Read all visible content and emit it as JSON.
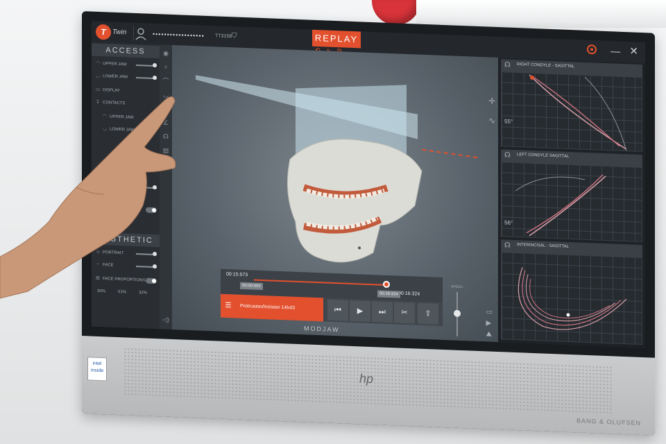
{
  "app": {
    "logo_letter": "T",
    "logo_name": "Twin",
    "password_mask": "••••••••••••••••••",
    "code": "TT3158",
    "mode_button": "REPLAY"
  },
  "left_panel": {
    "access_title": "ACCESS",
    "access_rows": [
      "UPPER JAW",
      "LOWER JAW",
      "DISPLAY",
      "CONTACTS",
      "UPPER JAW",
      "LOWER JAW"
    ],
    "aesthetic_title": "AESTHETIC",
    "aesthetic_rows": [
      "PORTRAIT",
      "FACE",
      "FACE PROPORTIONS"
    ],
    "aesthetic_stats": [
      "30%",
      "51%",
      "32%"
    ]
  },
  "player": {
    "current_time": "00:15:573",
    "start_marker": "00:00:000",
    "end_time": "00:16:324",
    "end_marker": "00:16:324",
    "clip_name": "Protrusion/Incision 14h43",
    "speed_label": "SPEED",
    "controls": [
      "previous",
      "play",
      "next",
      "cut",
      "share"
    ]
  },
  "brand": {
    "viewport_brand": "MODJAW",
    "chin_logo": "hp",
    "chin_brand": "BANG & OLUFSEN"
  },
  "right_panel": {
    "graphs": [
      {
        "title": "RIGHT CONDYLE - SAGITTAL",
        "angle": "55°"
      },
      {
        "title": "LEFT CONDYLE SAGITTAL",
        "angle": "56°"
      },
      {
        "title": "INTERINCISAL - SAGITTAL",
        "angle": ""
      }
    ]
  },
  "colors": {
    "accent": "#e2502e",
    "panel": "#2a2e33",
    "viewport": "#59626a"
  }
}
